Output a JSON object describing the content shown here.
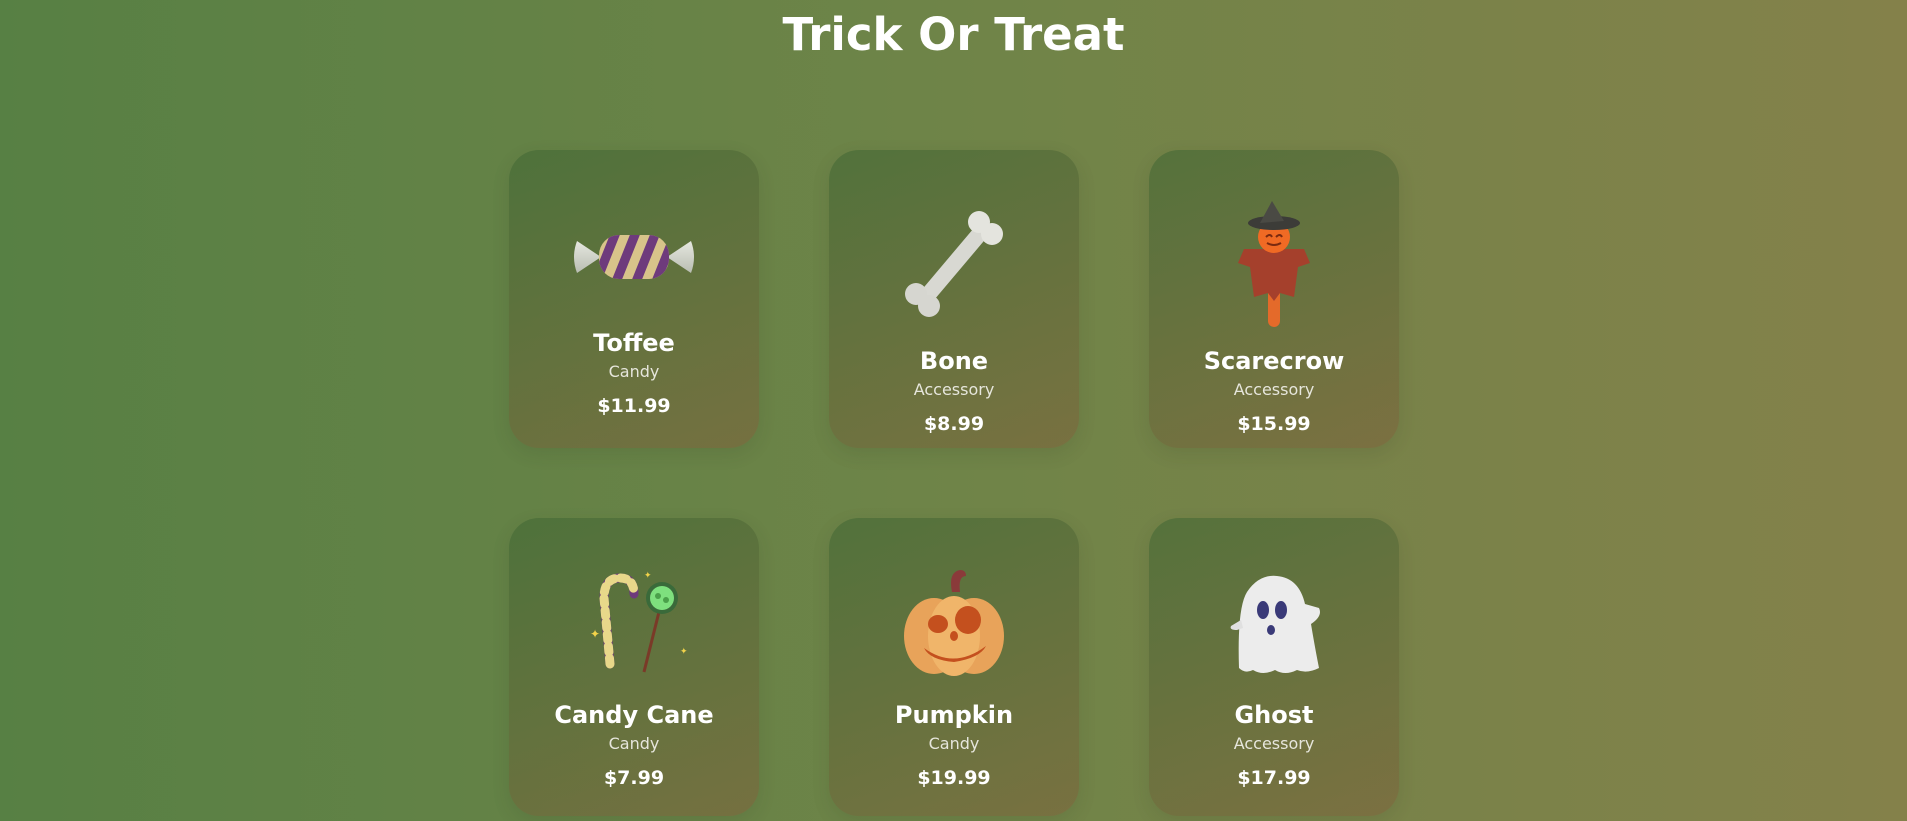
{
  "page": {
    "title": "Trick Or Treat"
  },
  "colors": {
    "background_left": "#578044",
    "background_right": "#84814a",
    "text": "#ffffff"
  },
  "products": [
    {
      "name": "Toffee",
      "category": "Candy",
      "price": "$11.99",
      "icon": "toffee-candy-icon"
    },
    {
      "name": "Bone",
      "category": "Accessory",
      "price": "$8.99",
      "icon": "bone-icon"
    },
    {
      "name": "Scarecrow",
      "category": "Accessory",
      "price": "$15.99",
      "icon": "scarecrow-icon"
    },
    {
      "name": "Candy Cane",
      "category": "Candy",
      "price": "$7.99",
      "icon": "candy-cane-lollipop-icon"
    },
    {
      "name": "Pumpkin",
      "category": "Candy",
      "price": "$19.99",
      "icon": "pumpkin-icon"
    },
    {
      "name": "Ghost",
      "category": "Accessory",
      "price": "$17.99",
      "icon": "ghost-icon"
    }
  ]
}
